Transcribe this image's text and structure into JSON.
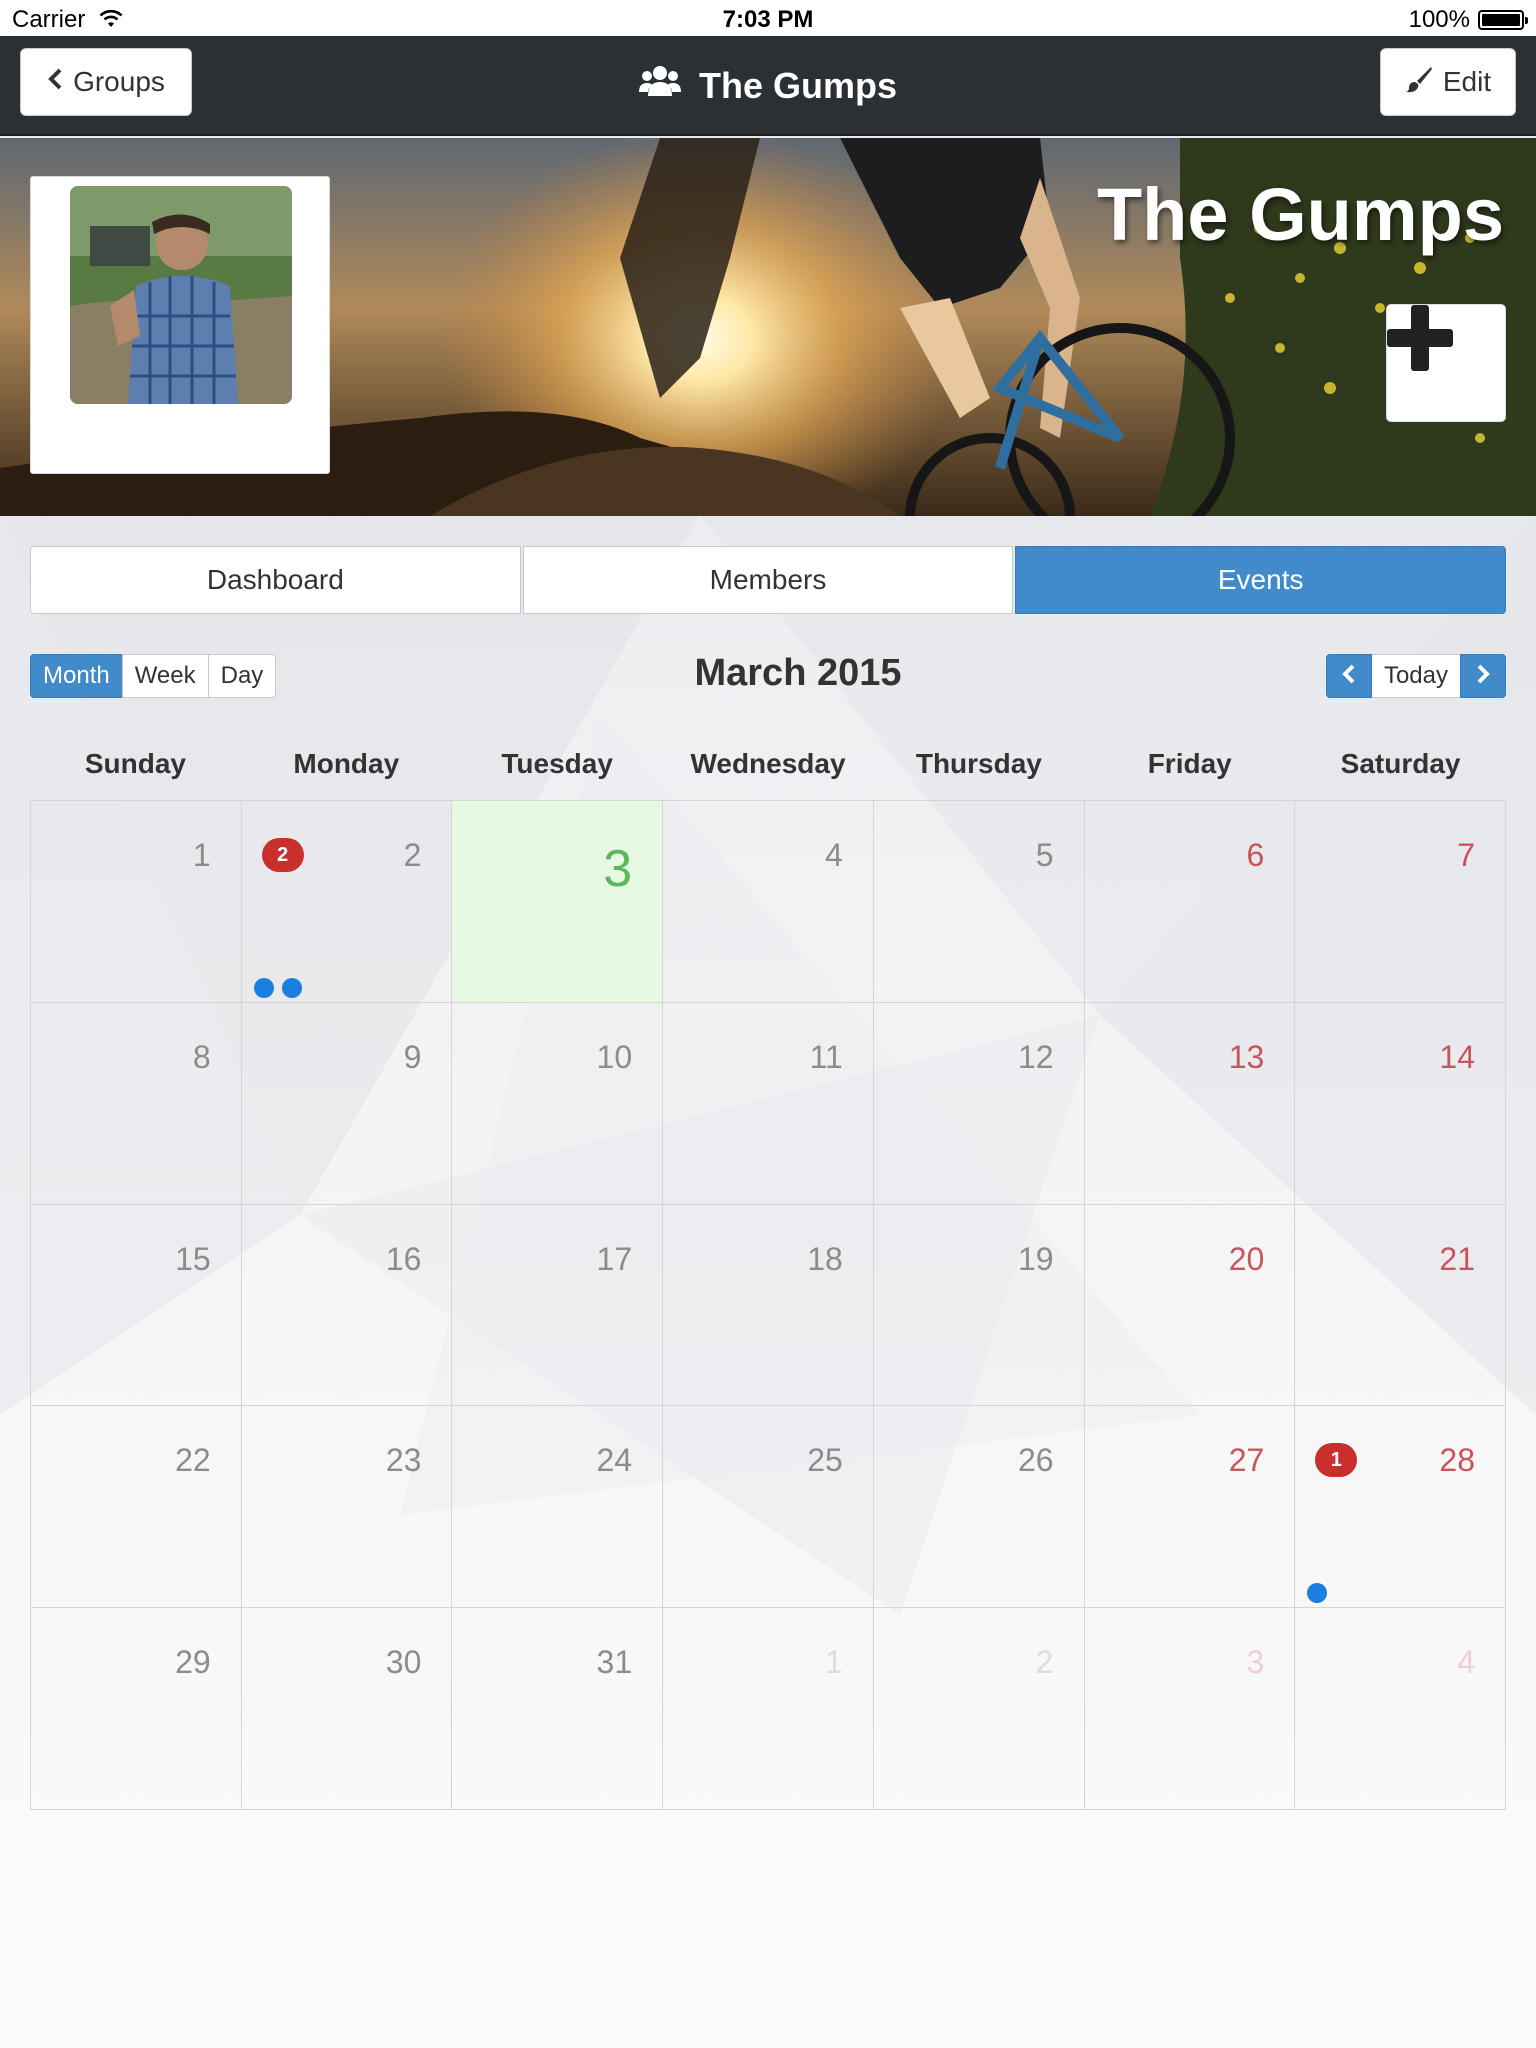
{
  "status_bar": {
    "carrier": "Carrier",
    "time": "7:03 PM",
    "battery": "100%"
  },
  "nav": {
    "back_label": "Groups",
    "title": "The Gumps",
    "edit_label": "Edit"
  },
  "banner": {
    "title": "The Gumps"
  },
  "tabs": [
    {
      "label": "Dashboard",
      "active": false
    },
    {
      "label": "Members",
      "active": false
    },
    {
      "label": "Events",
      "active": true
    }
  ],
  "calendar": {
    "views": [
      "Month",
      "Week",
      "Day"
    ],
    "active_view": "Month",
    "title": "March 2015",
    "today_label": "Today",
    "weekdays": [
      "Sunday",
      "Monday",
      "Tuesday",
      "Wednesday",
      "Thursday",
      "Friday",
      "Saturday"
    ],
    "days": [
      {
        "n": "1"
      },
      {
        "n": "2",
        "badge": "2",
        "events": 2
      },
      {
        "n": "3",
        "today": true
      },
      {
        "n": "4"
      },
      {
        "n": "5"
      },
      {
        "n": "6",
        "weekend": true
      },
      {
        "n": "7",
        "weekend": true
      },
      {
        "n": "8"
      },
      {
        "n": "9"
      },
      {
        "n": "10"
      },
      {
        "n": "11"
      },
      {
        "n": "12"
      },
      {
        "n": "13",
        "weekend": true
      },
      {
        "n": "14",
        "weekend": true
      },
      {
        "n": "15"
      },
      {
        "n": "16"
      },
      {
        "n": "17"
      },
      {
        "n": "18"
      },
      {
        "n": "19"
      },
      {
        "n": "20",
        "weekend": true
      },
      {
        "n": "21",
        "weekend": true
      },
      {
        "n": "22"
      },
      {
        "n": "23"
      },
      {
        "n": "24"
      },
      {
        "n": "25"
      },
      {
        "n": "26"
      },
      {
        "n": "27",
        "weekend": true
      },
      {
        "n": "28",
        "weekend": true,
        "badge": "1",
        "events": 1
      },
      {
        "n": "29"
      },
      {
        "n": "30"
      },
      {
        "n": "31"
      },
      {
        "n": "1",
        "other": true
      },
      {
        "n": "2",
        "other": true
      },
      {
        "n": "3",
        "other": true,
        "weekend": true
      },
      {
        "n": "4",
        "other": true,
        "weekend": true
      }
    ]
  },
  "colors": {
    "accent": "#428bca",
    "navbar": "#2b3035",
    "today_bg": "#e6f9e3",
    "weekend_text": "#c9545d",
    "event_dot": "#1a7fe0",
    "badge": "#c9302c"
  }
}
